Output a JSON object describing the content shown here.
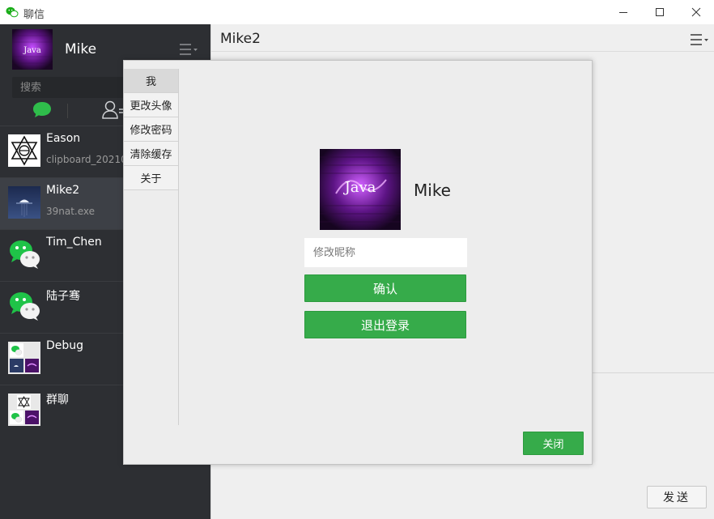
{
  "window": {
    "title": "聊信",
    "app_icon": "wechat-logo-icon",
    "controls": [
      "minimize-icon",
      "maximize-icon",
      "close-icon"
    ]
  },
  "sidebar": {
    "profile": {
      "name": "Mike",
      "avatar_text": "Java",
      "menu_icon": "hamburger-menu-icon"
    },
    "search": {
      "placeholder": "搜索",
      "value": ""
    },
    "tabs": [
      {
        "icon": "chat-bubble-icon",
        "active": true
      },
      {
        "icon": "contacts-icon",
        "active": false
      }
    ],
    "contacts": [
      {
        "name": "Eason",
        "preview": "clipboard_20210",
        "avatar": "pattern-avatar",
        "active": false
      },
      {
        "name": "Mike2",
        "preview": "39nat.exe",
        "avatar": "landscape-avatar",
        "active": true
      },
      {
        "name": "Tim_Chen",
        "preview": "",
        "avatar": "wechat-avatar",
        "active": false
      },
      {
        "name": "陆子骞",
        "preview": "",
        "avatar": "wechat-avatar",
        "active": false
      },
      {
        "name": "Debug",
        "preview": "",
        "avatar": "group-avatar",
        "active": false
      },
      {
        "name": "群聊",
        "preview": "",
        "avatar": "group-avatar",
        "active": false
      }
    ]
  },
  "main": {
    "chat_title": "Mike2",
    "menu_icon": "hamburger-menu-icon",
    "send_label": "发送"
  },
  "dialog": {
    "nav": [
      "我",
      "更改头像",
      "修改密码",
      "清除缓存",
      "关于"
    ],
    "active_nav": "我",
    "user_name": "Mike",
    "avatar_text": "Java",
    "nickname_placeholder": "修改昵称",
    "nickname_value": "",
    "confirm_label": "确认",
    "logout_label": "退出登录",
    "close_label": "关闭"
  },
  "colors": {
    "sidebar_bg": "#2d2f33",
    "accent_green": "#36ab4a",
    "main_bg": "#efefef"
  }
}
